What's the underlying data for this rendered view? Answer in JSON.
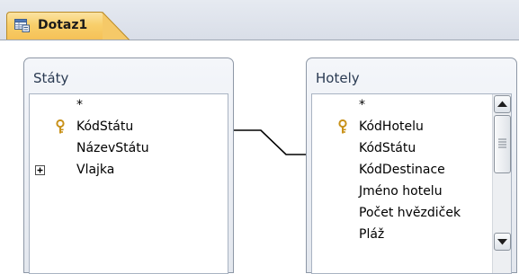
{
  "tab": {
    "label": "Dotaz1",
    "icon": "query-icon"
  },
  "tables": [
    {
      "title": "Státy",
      "fields": [
        {
          "name": "*",
          "key": false,
          "expand": false
        },
        {
          "name": "KódStátu",
          "key": true,
          "expand": false
        },
        {
          "name": "NázevStátu",
          "key": false,
          "expand": false
        },
        {
          "name": "Vlajka",
          "key": false,
          "expand": true
        }
      ]
    },
    {
      "title": "Hotely",
      "fields": [
        {
          "name": "*",
          "key": false,
          "expand": false
        },
        {
          "name": "KódHotelu",
          "key": true,
          "expand": false
        },
        {
          "name": "KódStátu",
          "key": false,
          "expand": false
        },
        {
          "name": "KódDestinace",
          "key": false,
          "expand": false
        },
        {
          "name": "Jméno hotelu",
          "key": false,
          "expand": false
        },
        {
          "name": "Počet hvězdiček",
          "key": false,
          "expand": false
        },
        {
          "name": "Pláž",
          "key": false,
          "expand": false
        }
      ]
    }
  ],
  "relationship": {
    "from": "Státy.KódStátu",
    "to": "Hotely.KódStátu"
  },
  "colors": {
    "tab_active": "#f8cf6b",
    "key_gold": "#d9a520",
    "relation_line": "#000000"
  }
}
